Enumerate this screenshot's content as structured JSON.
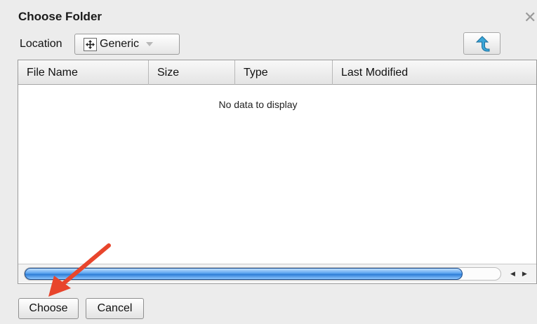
{
  "dialog": {
    "title": "Choose Folder",
    "close_glyph": "✕"
  },
  "location": {
    "label": "Location",
    "value": "Generic",
    "icon": "move-arrows-icon"
  },
  "toolbar": {
    "up_icon": "up-folder-arrow-icon"
  },
  "grid": {
    "columns": [
      "File Name",
      "Size",
      "Type",
      "Last Modified"
    ],
    "rows": [],
    "empty_message": "No data to display"
  },
  "buttons": {
    "choose_label": "Choose",
    "cancel_label": "Cancel"
  },
  "colors": {
    "accent": "#2f7ed6",
    "annotation_arrow": "#e8452c"
  }
}
